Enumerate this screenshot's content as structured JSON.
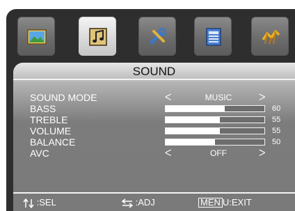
{
  "menu": {
    "tabs": [
      {
        "icon": "picture-icon",
        "active": false
      },
      {
        "icon": "sound-note-icon",
        "active": true
      },
      {
        "icon": "setup-tools-icon",
        "active": false
      },
      {
        "icon": "feature-panel-icon",
        "active": false
      },
      {
        "icon": "channel-antenna-icon",
        "active": false
      }
    ],
    "title": "SOUND",
    "items": [
      {
        "label": "SOUND MODE",
        "type": "option",
        "value": "MUSIC"
      },
      {
        "label": "BASS",
        "type": "slider",
        "level": 60,
        "value": "60"
      },
      {
        "label": "TREBLE",
        "type": "slider",
        "level": 55,
        "value": "55"
      },
      {
        "label": "VOLUME",
        "type": "slider",
        "level": 55,
        "value": "55"
      },
      {
        "label": "BALANCE",
        "type": "slider",
        "level": 50,
        "value": "50"
      },
      {
        "label": "AVC",
        "type": "option",
        "value": "OFF"
      }
    ],
    "footer": {
      "sel_label": ":SEL",
      "adj_label": ":ADJ",
      "exit_key": "MEN",
      "exit_label": "U:EXIT"
    },
    "colors": {
      "background": "#2e2e2e",
      "panel_top": "#e6e6e6",
      "panel_bottom": "#7a7a7a",
      "text": "#ffffff"
    }
  }
}
